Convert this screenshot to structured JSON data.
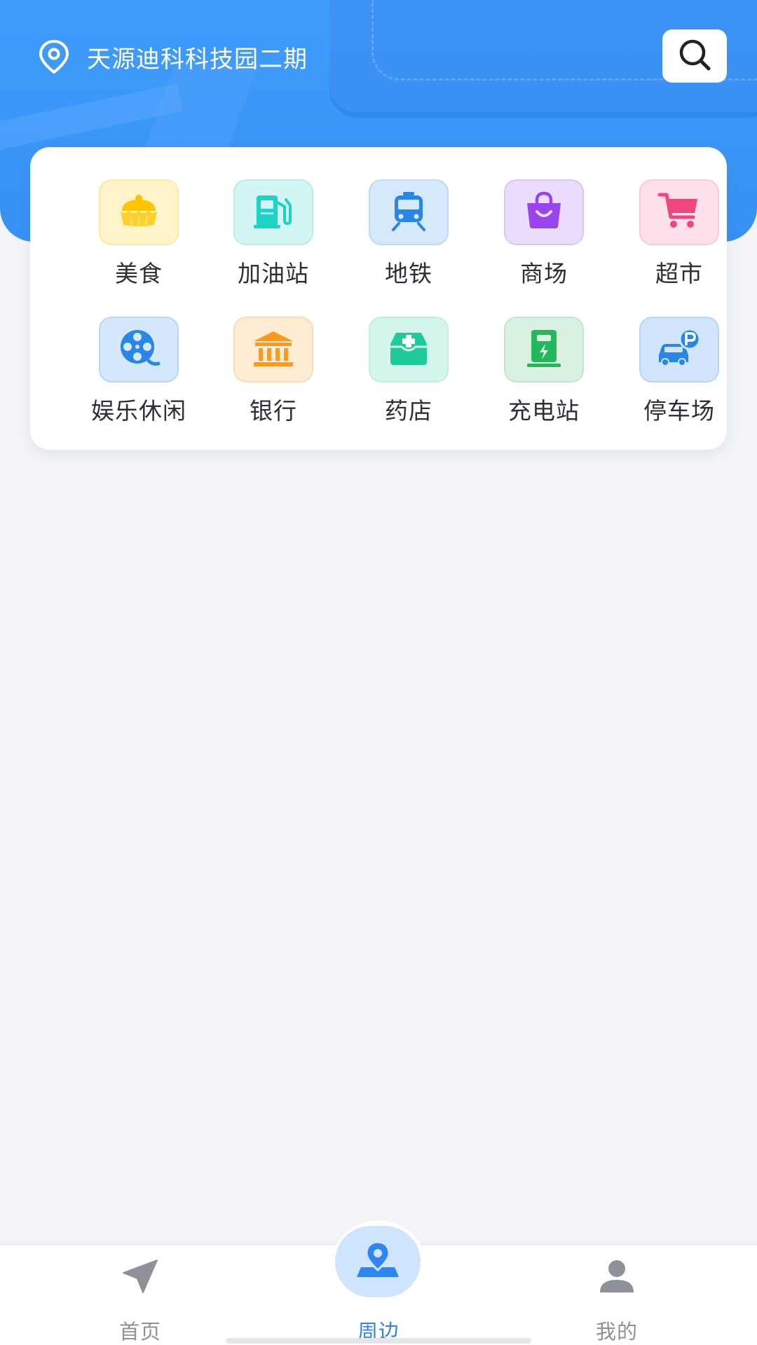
{
  "header": {
    "location_name": "天源迪科科技园二期",
    "search_icon": "search-icon",
    "location_icon": "location-pin-icon"
  },
  "categories": [
    {
      "label": "美食",
      "icon": "food-cake-icon",
      "tile_bg": "#fff3c9",
      "tile_border": "#ffe9a6",
      "icon_color": "#ffc400"
    },
    {
      "label": "加油站",
      "icon": "gas-station-icon",
      "tile_bg": "#d3f6f4",
      "tile_border": "#b9ede9",
      "icon_color": "#1dd3c3"
    },
    {
      "label": "地铁",
      "icon": "subway-train-icon",
      "tile_bg": "#d6e9fb",
      "tile_border": "#bcdaf7",
      "icon_color": "#2a86e6"
    },
    {
      "label": "商场",
      "icon": "shopping-bag-icon",
      "tile_bg": "#eadcfb",
      "tile_border": "#dac4f7",
      "icon_color": "#9a44f0"
    },
    {
      "label": "超市",
      "icon": "shopping-cart-icon",
      "tile_bg": "#fde0ec",
      "tile_border": "#f9c9dc",
      "icon_color": "#f0467d"
    },
    {
      "label": "娱乐休闲",
      "icon": "film-reel-icon",
      "tile_bg": "#d3e8fb",
      "tile_border": "#b6d7f7",
      "icon_color": "#2a86e6"
    },
    {
      "label": "银行",
      "icon": "bank-icon",
      "tile_bg": "#feebd2",
      "tile_border": "#fbdcb4",
      "icon_color": "#fb9a1c"
    },
    {
      "label": "药店",
      "icon": "medicine-box-icon",
      "tile_bg": "#d5f6ec",
      "tile_border": "#bcefdf",
      "icon_color": "#1fcc99"
    },
    {
      "label": "充电站",
      "icon": "charging-station-icon",
      "tile_bg": "#d8f1e0",
      "tile_border": "#bfe6cb",
      "icon_color": "#23b85c"
    },
    {
      "label": "停车场",
      "icon": "parking-car-icon",
      "tile_bg": "#d0e5fb",
      "tile_border": "#b6d6f7",
      "icon_color": "#2a86e6"
    }
  ],
  "tabbar": {
    "tabs": [
      {
        "label": "首页",
        "icon": "navigation-arrow-icon",
        "active": false
      },
      {
        "label": "周边",
        "icon": "nearby-location-icon",
        "active": true
      },
      {
        "label": "我的",
        "icon": "user-profile-icon",
        "active": false
      }
    ],
    "active_color": "#2f86f2",
    "inactive_color": "#8e9199"
  },
  "colors": {
    "hero_blue": "#3b97f7",
    "page_bg": "#f2f4f8"
  }
}
